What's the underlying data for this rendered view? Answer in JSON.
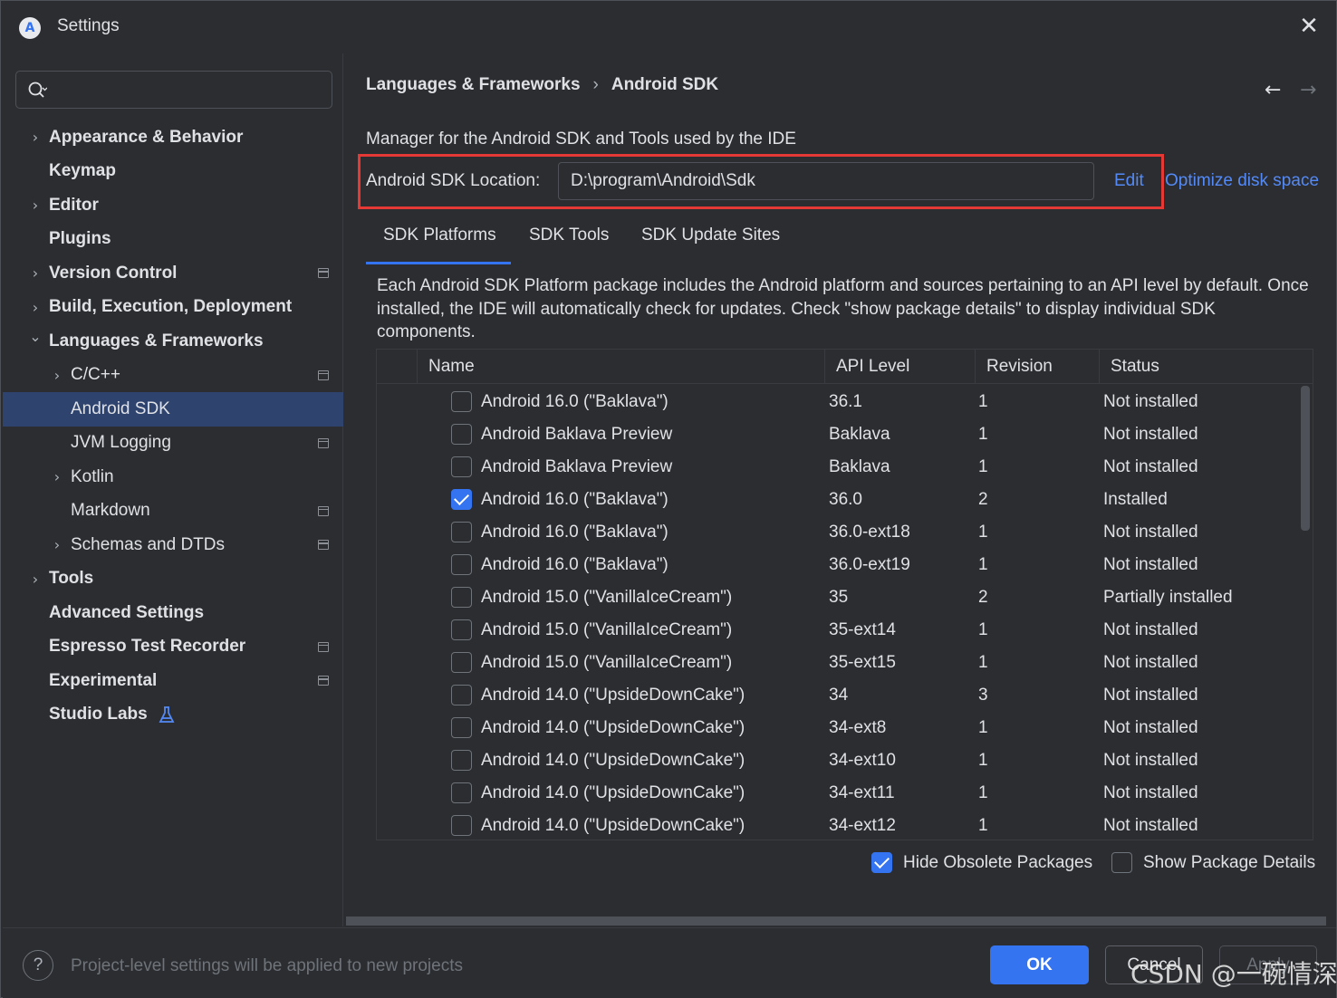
{
  "window": {
    "title": "Settings"
  },
  "search": {
    "placeholder": ""
  },
  "sidebar": {
    "items": [
      {
        "label": "Appearance & Behavior",
        "bold": true,
        "chevron": ">",
        "indent": 0,
        "project": false
      },
      {
        "label": "Keymap",
        "bold": true,
        "chevron": "",
        "indent": 0,
        "project": false
      },
      {
        "label": "Editor",
        "bold": true,
        "chevron": ">",
        "indent": 0,
        "project": false
      },
      {
        "label": "Plugins",
        "bold": true,
        "chevron": "",
        "indent": 0,
        "project": false
      },
      {
        "label": "Version Control",
        "bold": true,
        "chevron": ">",
        "indent": 0,
        "project": true
      },
      {
        "label": "Build, Execution, Deployment",
        "bold": true,
        "chevron": ">",
        "indent": 0,
        "project": false
      },
      {
        "label": "Languages & Frameworks",
        "bold": true,
        "chevron": "v",
        "indent": 0,
        "project": false
      },
      {
        "label": "C/C++",
        "bold": false,
        "chevron": ">",
        "indent": 1,
        "project": true
      },
      {
        "label": "Android SDK",
        "bold": false,
        "chevron": "",
        "indent": 1,
        "project": false,
        "selected": true
      },
      {
        "label": "JVM Logging",
        "bold": false,
        "chevron": "",
        "indent": 1,
        "project": true
      },
      {
        "label": "Kotlin",
        "bold": false,
        "chevron": ">",
        "indent": 1,
        "project": false
      },
      {
        "label": "Markdown",
        "bold": false,
        "chevron": "",
        "indent": 1,
        "project": true
      },
      {
        "label": "Schemas and DTDs",
        "bold": false,
        "chevron": ">",
        "indent": 1,
        "project": true
      },
      {
        "label": "Tools",
        "bold": true,
        "chevron": ">",
        "indent": 0,
        "project": false
      },
      {
        "label": "Advanced Settings",
        "bold": true,
        "chevron": "",
        "indent": 0,
        "project": false
      },
      {
        "label": "Espresso Test Recorder",
        "bold": true,
        "chevron": "",
        "indent": 0,
        "project": true
      },
      {
        "label": "Experimental",
        "bold": true,
        "chevron": "",
        "indent": 0,
        "project": true
      },
      {
        "label": "Studio Labs",
        "bold": true,
        "chevron": "",
        "indent": 0,
        "project": false,
        "icon": "flask-icon"
      }
    ]
  },
  "breadcrumb": {
    "parent": "Languages & Frameworks",
    "separator": "›",
    "current": "Android SDK"
  },
  "nav": {
    "back": "←",
    "forward": "→"
  },
  "main": {
    "description": "Manager for the Android SDK and Tools used by the IDE",
    "location_label": "Android SDK Location:",
    "location_value": "D:\\program\\Android\\Sdk",
    "edit_link": "Edit",
    "optimize_link": "Optimize disk space",
    "tabs": [
      {
        "label": "SDK Platforms",
        "active": true
      },
      {
        "label": "SDK Tools",
        "active": false
      },
      {
        "label": "SDK Update Sites",
        "active": false
      }
    ],
    "package_description": "Each Android SDK Platform package includes the Android platform and sources pertaining to an API level by default. Once installed, the IDE will automatically check for updates. Check \"show package details\" to display individual SDK components."
  },
  "table": {
    "columns": [
      "Name",
      "API Level",
      "Revision",
      "Status"
    ],
    "rows": [
      {
        "checked": false,
        "name": "Android 16.0 (\"Baklava\")",
        "api": "36.1",
        "revision": "1",
        "status": "Not installed"
      },
      {
        "checked": false,
        "name": "Android Baklava Preview",
        "api": "Baklava",
        "revision": "1",
        "status": "Not installed"
      },
      {
        "checked": false,
        "name": "Android Baklava Preview",
        "api": "Baklava",
        "revision": "1",
        "status": "Not installed"
      },
      {
        "checked": true,
        "name": "Android 16.0 (\"Baklava\")",
        "api": "36.0",
        "revision": "2",
        "status": "Installed"
      },
      {
        "checked": false,
        "name": "Android 16.0 (\"Baklava\")",
        "api": "36.0-ext18",
        "revision": "1",
        "status": "Not installed"
      },
      {
        "checked": false,
        "name": "Android 16.0 (\"Baklava\")",
        "api": "36.0-ext19",
        "revision": "1",
        "status": "Not installed"
      },
      {
        "checked": false,
        "name": "Android 15.0 (\"VanillaIceCream\")",
        "api": "35",
        "revision": "2",
        "status": "Partially installed"
      },
      {
        "checked": false,
        "name": "Android 15.0 (\"VanillaIceCream\")",
        "api": "35-ext14",
        "revision": "1",
        "status": "Not installed"
      },
      {
        "checked": false,
        "name": "Android 15.0 (\"VanillaIceCream\")",
        "api": "35-ext15",
        "revision": "1",
        "status": "Not installed"
      },
      {
        "checked": false,
        "name": "Android 14.0 (\"UpsideDownCake\")",
        "api": "34",
        "revision": "3",
        "status": "Not installed"
      },
      {
        "checked": false,
        "name": "Android 14.0 (\"UpsideDownCake\")",
        "api": "34-ext8",
        "revision": "1",
        "status": "Not installed"
      },
      {
        "checked": false,
        "name": "Android 14.0 (\"UpsideDownCake\")",
        "api": "34-ext10",
        "revision": "1",
        "status": "Not installed"
      },
      {
        "checked": false,
        "name": "Android 14.0 (\"UpsideDownCake\")",
        "api": "34-ext11",
        "revision": "1",
        "status": "Not installed"
      },
      {
        "checked": false,
        "name": "Android 14.0 (\"UpsideDownCake\")",
        "api": "34-ext12",
        "revision": "1",
        "status": "Not installed"
      }
    ]
  },
  "options": {
    "hide_obsolete": {
      "label": "Hide Obsolete Packages",
      "checked": true
    },
    "show_details": {
      "label": "Show Package Details",
      "checked": false
    }
  },
  "footer": {
    "help": "?",
    "note": "Project-level settings will be applied to new projects",
    "ok": "OK",
    "cancel": "Cancel",
    "apply": "Apply"
  },
  "watermark": "CSDN @一碗情深",
  "colors": {
    "accent": "#3574f0",
    "link": "#548af7",
    "highlight_box": "#e53935",
    "selection": "#2e436e",
    "background": "#2b2d30"
  }
}
